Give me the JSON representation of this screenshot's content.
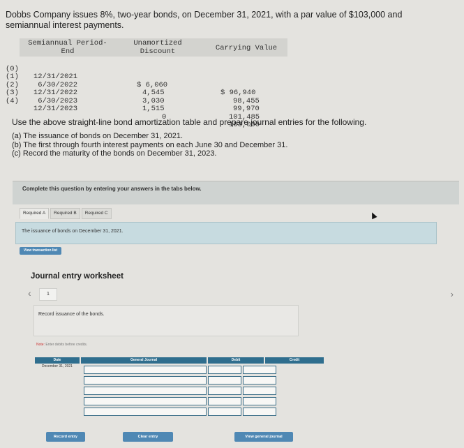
{
  "problem": {
    "line1": "Dobbs Company issues 8%, two-year bonds, on December 31, 2021, with a par value of $103,000 and",
    "line2": "semiannual interest payments."
  },
  "amortization_table": {
    "headers": {
      "period_line1": "Semiannual Period-",
      "period_line2": "End",
      "discount_line1": "Unamortized",
      "discount_line2": "Discount",
      "carrying": "Carrying Value"
    },
    "rows": [
      {
        "index": "(0)",
        "date": "12/31/2021",
        "discount": "$ 6,060",
        "carrying": "$ 96,940"
      },
      {
        "index": "(1)",
        "date": " 6/30/2022",
        "discount": "4,545",
        "carrying": "98,455"
      },
      {
        "index": "(2)",
        "date": "12/31/2022",
        "discount": "3,030",
        "carrying": "99,970"
      },
      {
        "index": "(3)",
        "date": " 6/30/2023",
        "discount": "1,515",
        "carrying": "101,485"
      },
      {
        "index": "(4)",
        "date": "12/31/2023",
        "discount": "0",
        "carrying": "103,000"
      }
    ]
  },
  "instructions": "Use the above straight-line bond amortization table and prepare journal entries for the following.",
  "parts": [
    "(a) The issuance of bonds on December 31, 2021.",
    "(b) The first through fourth interest payments on each June 30 and December 31.",
    "(c) Record the maturity of the bonds on December 31, 2023."
  ],
  "banner": "Complete this question by entering your answers in the tabs below.",
  "tabs": [
    "Required A",
    "Required B",
    "Required C"
  ],
  "subquestion": "The issuance of bonds on December 31, 2021.",
  "view_transaction_list": "View transaction list",
  "worksheet": {
    "title": "Journal entry worksheet",
    "page": "1",
    "card_text": "Record issuance of the bonds.",
    "note_prefix": "Note:",
    "note_text": " Enter debits before credits.",
    "col_date": "Date",
    "col_general_journal": "General Journal",
    "col_debit": "Debit",
    "col_credit": "Credit",
    "date_value": "December 31, 2021"
  },
  "buttons": {
    "record_entry": "Record entry",
    "clear_entry": "Clear entry",
    "view_general_journal": "View general journal"
  },
  "colors": {
    "page_bg": "#e4e3df",
    "header_blue": "#2f6e8e",
    "button_blue": "#4f88b4",
    "subq_bg": "#c7dbe0"
  }
}
